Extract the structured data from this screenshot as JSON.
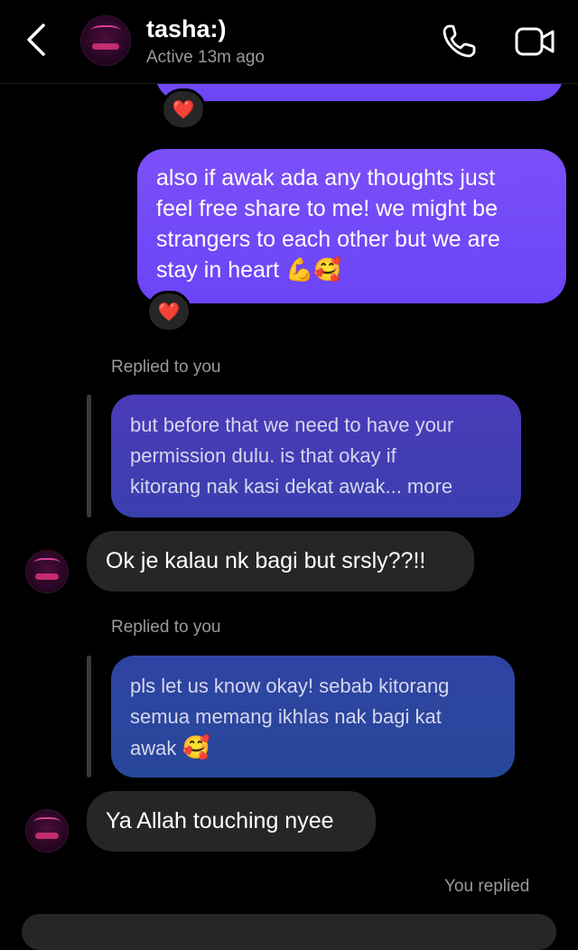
{
  "header": {
    "contact_name": "tasha:)",
    "status": "Active 13m ago"
  },
  "icons": {
    "back": "chevron-left-icon",
    "call": "phone-icon",
    "video": "video-camera-icon",
    "reaction": "heart-emoji"
  },
  "colors": {
    "sent_bubble": "#6f49f8",
    "received_bubble": "#262626",
    "quoted_top": "#4c3bb8",
    "quoted_bottom": "#2d46a0",
    "reaction_heart": "#ff2d3c"
  },
  "messages": [
    {
      "type": "sent",
      "lines": [
        "also if awak ada any thoughts just",
        "feel free share to me! we might be",
        "strangers to each other but we are",
        "stay in heart"
      ],
      "emojis": "💪🥰",
      "reaction": "❤️"
    },
    {
      "type": "received_reply",
      "reply_label": "Replied to you",
      "quoted_lines": [
        "but before that we need to have your",
        "permission dulu. is that okay if",
        "kitorang nak kasi dekat awak... more"
      ],
      "text": "Ok je kalau nk bagi but srsly??!!"
    },
    {
      "type": "received_reply",
      "reply_label": "Replied to you",
      "quoted_lines": [
        "pls let us know okay! sebab kitorang",
        "semua memang ikhlas nak bagi kat",
        "awak"
      ],
      "quoted_emoji": "🥰",
      "text": "Ya Allah touching nyee"
    },
    {
      "type": "sent_reply",
      "reply_label": "You replied"
    }
  ],
  "top_reaction": "❤️"
}
